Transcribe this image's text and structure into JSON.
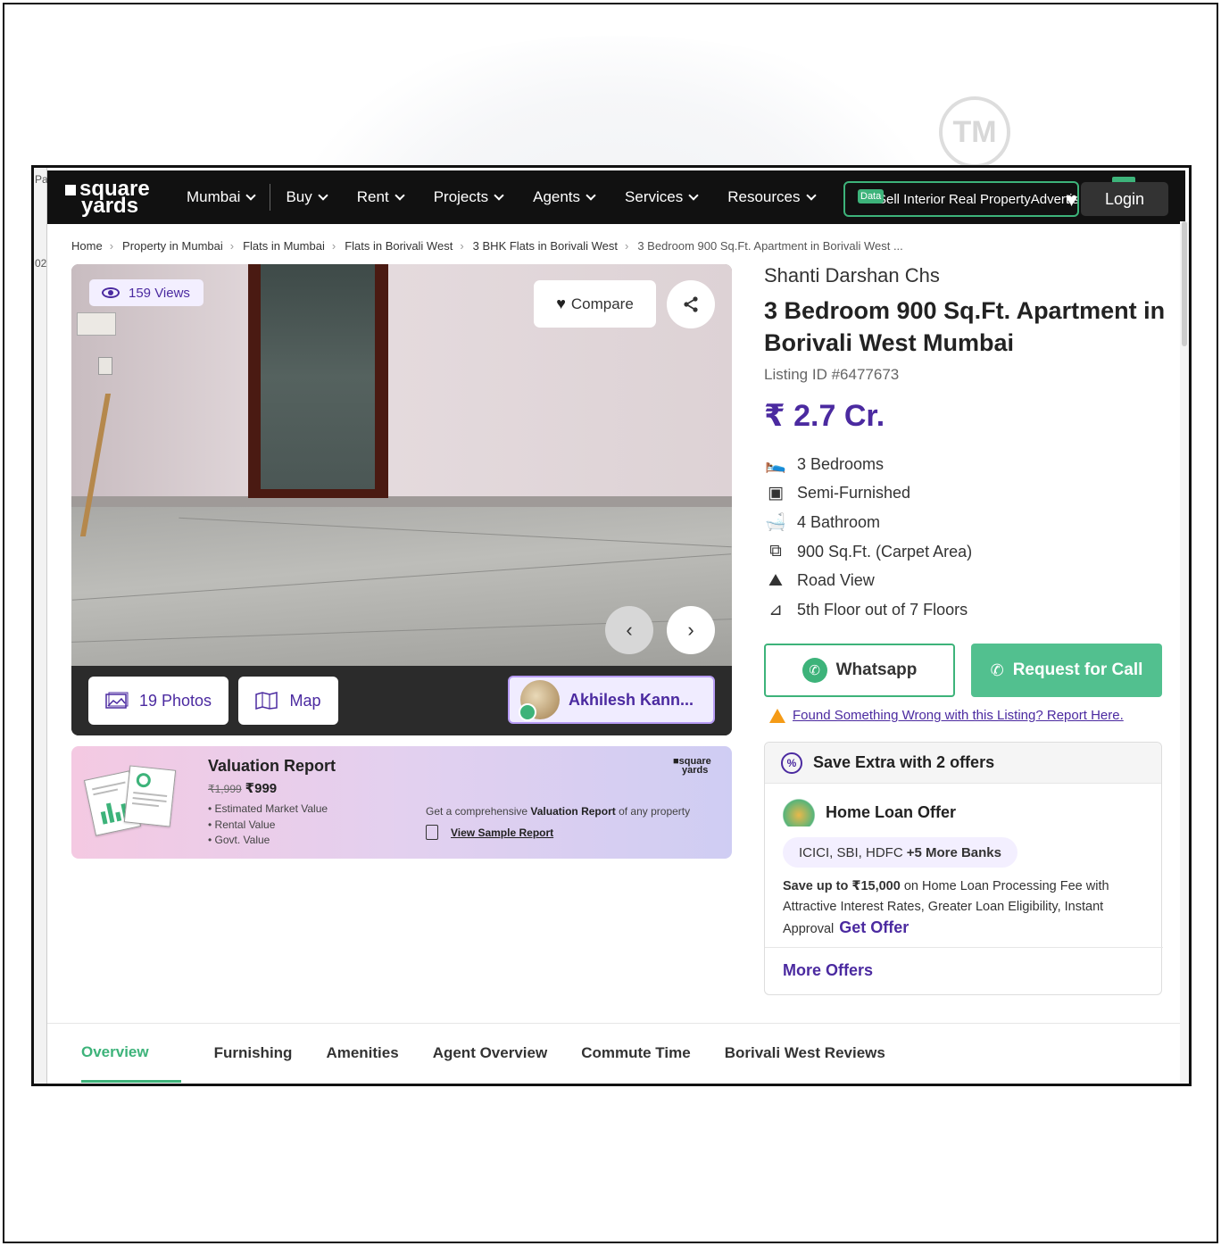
{
  "watermark": {
    "tm": "TM"
  },
  "left_strip": {
    "t1": "Pa",
    "t2": "02"
  },
  "nav": {
    "logo_top": "square",
    "logo_bottom": "yards",
    "items": [
      {
        "label": "Mumbai"
      },
      {
        "label": "Buy"
      },
      {
        "label": "Rent"
      },
      {
        "label": "Projects"
      },
      {
        "label": "Agents"
      },
      {
        "label": "Services"
      },
      {
        "label": "Resources"
      }
    ],
    "extra_badge": "Data",
    "extra_text": "Sell Interior Real PropertyAdvertise w",
    "login": "Login"
  },
  "breadcrumb": [
    "Home",
    "Property in Mumbai",
    "Flats in Mumbai",
    "Flats in Borivali West",
    "3 BHK Flats in Borivali West",
    "3 Bedroom 900 Sq.Ft. Apartment in Borivali West ..."
  ],
  "gallery": {
    "views": "159 Views",
    "compare": "Compare",
    "photos": "19 Photos",
    "map": "Map",
    "agent": "Akhilesh Kann..."
  },
  "valuation": {
    "title": "Valuation Report",
    "old_price": "₹1,999",
    "price": "₹999",
    "items": [
      "Estimated Market Value",
      "Rental Value",
      "Govt. Value"
    ],
    "brand_top": "square",
    "brand_bottom": "yards",
    "desc_pre": "Get a comprehensive ",
    "desc_bold": "Valuation Report",
    "desc_post": " of any property",
    "sample": "View Sample Report"
  },
  "listing": {
    "project": "Shanti Darshan Chs",
    "title": "3 Bedroom 900 Sq.Ft. Apartment in Borivali West Mumbai",
    "listing_id": "Listing ID #6477673",
    "price": "₹ 2.7 Cr.",
    "specs": [
      {
        "icon": "bed-icon",
        "text": "3 Bedrooms"
      },
      {
        "icon": "sofa-icon",
        "text": "Semi-Furnished"
      },
      {
        "icon": "bathtub-icon",
        "text": "4 Bathroom"
      },
      {
        "icon": "area-icon",
        "text": "900 Sq.Ft. (Carpet Area)"
      },
      {
        "icon": "view-icon",
        "text": "Road View"
      },
      {
        "icon": "floor-icon",
        "text": "5th Floor out of 7 Floors"
      }
    ],
    "whatsapp": "Whatsapp",
    "request_call": "Request for Call",
    "report": "Found Something Wrong with this Listing? Report Here."
  },
  "offers": {
    "header": "Save Extra with 2 offers",
    "loan_title": "Home Loan Offer",
    "banks": "ICICI, SBI, HDFC",
    "banks_more": "+5 More Banks",
    "text_bold": "Save up to ₹15,000",
    "text_rest": " on Home Loan Processing Fee with Attractive Interest Rates, Greater Loan Eligibility, Instant Approval",
    "get_offer": "Get Offer",
    "more": "More Offers"
  },
  "tabs": [
    {
      "label": "Overview"
    },
    {
      "label": "Furnishing"
    },
    {
      "label": "Amenities"
    },
    {
      "label": "Agent Overview"
    },
    {
      "label": "Commute Time"
    },
    {
      "label": "Borivali West Reviews"
    }
  ],
  "colors": {
    "brand_purple": "#4b2aa0",
    "brand_green": "#3db37a",
    "nav_bg": "#111111"
  }
}
